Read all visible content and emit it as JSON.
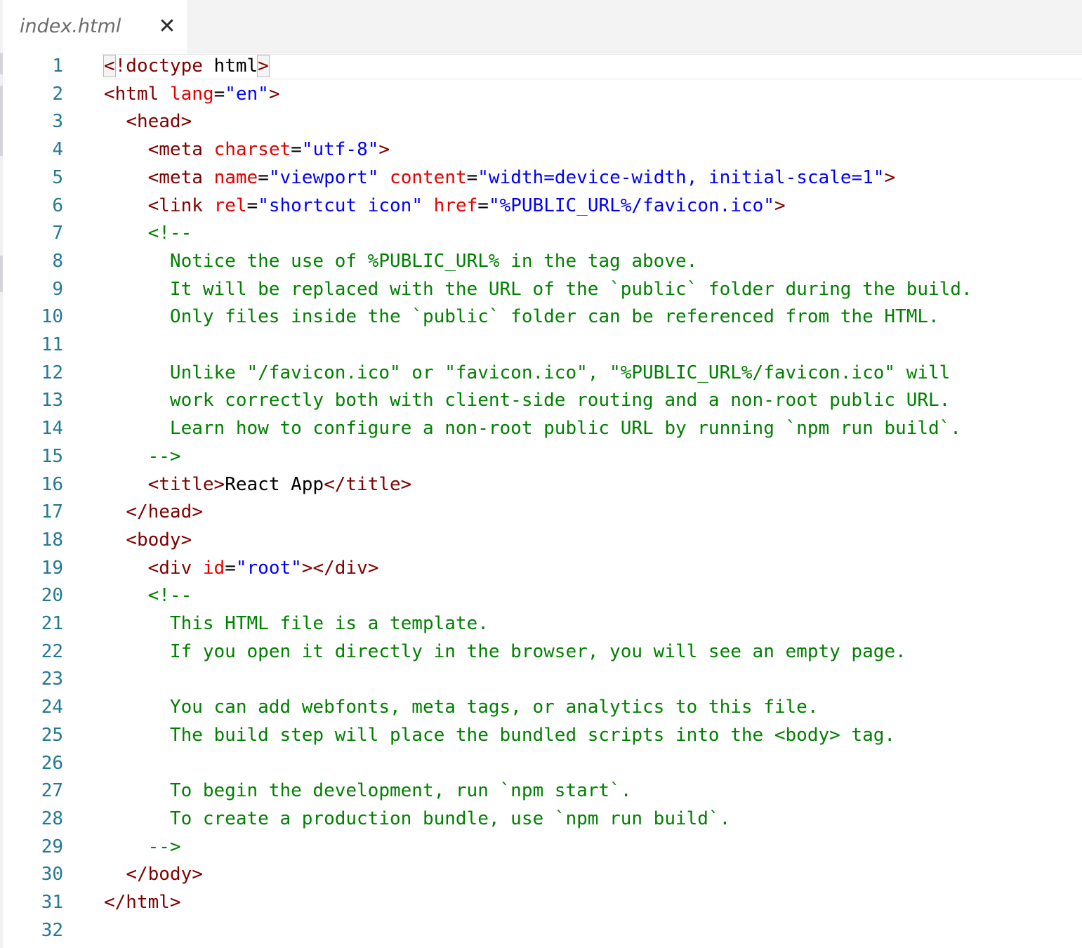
{
  "tab": {
    "filename": "index.html",
    "close_symbol": "✕"
  },
  "colors": {
    "tag": "#800000",
    "attribute": "#e50000",
    "string": "#0000ff",
    "comment": "#008000",
    "line_number": "#237893"
  },
  "lines": [
    {
      "n": "1",
      "tokens": [
        {
          "t": "tag",
          "v": "<",
          "hl": true
        },
        {
          "t": "tag",
          "v": "!doctype"
        },
        {
          "t": "txt",
          "v": " html"
        },
        {
          "t": "tag",
          "v": ">",
          "hl": true
        }
      ]
    },
    {
      "n": "2",
      "tokens": [
        {
          "t": "tag",
          "v": "<html"
        },
        {
          "t": "txt",
          "v": " "
        },
        {
          "t": "attr",
          "v": "lang"
        },
        {
          "t": "txt",
          "v": "="
        },
        {
          "t": "str",
          "v": "\"en\""
        },
        {
          "t": "tag",
          "v": ">"
        }
      ]
    },
    {
      "n": "3",
      "tokens": [
        {
          "t": "txt",
          "v": "  "
        },
        {
          "t": "tag",
          "v": "<head>"
        }
      ]
    },
    {
      "n": "4",
      "tokens": [
        {
          "t": "txt",
          "v": "    "
        },
        {
          "t": "tag",
          "v": "<meta"
        },
        {
          "t": "txt",
          "v": " "
        },
        {
          "t": "attr",
          "v": "charset"
        },
        {
          "t": "txt",
          "v": "="
        },
        {
          "t": "str",
          "v": "\"utf-8\""
        },
        {
          "t": "tag",
          "v": ">"
        }
      ]
    },
    {
      "n": "5",
      "tokens": [
        {
          "t": "txt",
          "v": "    "
        },
        {
          "t": "tag",
          "v": "<meta"
        },
        {
          "t": "txt",
          "v": " "
        },
        {
          "t": "attr",
          "v": "name"
        },
        {
          "t": "txt",
          "v": "="
        },
        {
          "t": "str",
          "v": "\"viewport\""
        },
        {
          "t": "txt",
          "v": " "
        },
        {
          "t": "attr",
          "v": "content"
        },
        {
          "t": "txt",
          "v": "="
        },
        {
          "t": "str",
          "v": "\"width=device-width, initial-scale=1\""
        },
        {
          "t": "tag",
          "v": ">"
        }
      ]
    },
    {
      "n": "6",
      "tokens": [
        {
          "t": "txt",
          "v": "    "
        },
        {
          "t": "tag",
          "v": "<link"
        },
        {
          "t": "txt",
          "v": " "
        },
        {
          "t": "attr",
          "v": "rel"
        },
        {
          "t": "txt",
          "v": "="
        },
        {
          "t": "str",
          "v": "\"shortcut icon\""
        },
        {
          "t": "txt",
          "v": " "
        },
        {
          "t": "attr",
          "v": "href"
        },
        {
          "t": "txt",
          "v": "="
        },
        {
          "t": "str",
          "v": "\"%PUBLIC_URL%/favicon.ico\""
        },
        {
          "t": "tag",
          "v": ">"
        }
      ]
    },
    {
      "n": "7",
      "tokens": [
        {
          "t": "txt",
          "v": "    "
        },
        {
          "t": "cmt",
          "v": "<!--"
        }
      ]
    },
    {
      "n": "8",
      "tokens": [
        {
          "t": "cmt",
          "v": "      Notice the use of %PUBLIC_URL% in the tag above."
        }
      ]
    },
    {
      "n": "9",
      "tokens": [
        {
          "t": "cmt",
          "v": "      It will be replaced with the URL of the `public` folder during the build."
        }
      ]
    },
    {
      "n": "10",
      "tokens": [
        {
          "t": "cmt",
          "v": "      Only files inside the `public` folder can be referenced from the HTML."
        }
      ]
    },
    {
      "n": "11",
      "tokens": []
    },
    {
      "n": "12",
      "tokens": [
        {
          "t": "cmt",
          "v": "      Unlike \"/favicon.ico\" or \"favicon.ico\", \"%PUBLIC_URL%/favicon.ico\" will"
        }
      ]
    },
    {
      "n": "13",
      "tokens": [
        {
          "t": "cmt",
          "v": "      work correctly both with client-side routing and a non-root public URL."
        }
      ]
    },
    {
      "n": "14",
      "tokens": [
        {
          "t": "cmt",
          "v": "      Learn how to configure a non-root public URL by running `npm run build`."
        }
      ]
    },
    {
      "n": "15",
      "tokens": [
        {
          "t": "cmt",
          "v": "    -->"
        }
      ]
    },
    {
      "n": "16",
      "tokens": [
        {
          "t": "txt",
          "v": "    "
        },
        {
          "t": "tag",
          "v": "<title>"
        },
        {
          "t": "txt",
          "v": "React App"
        },
        {
          "t": "tag",
          "v": "</title>"
        }
      ]
    },
    {
      "n": "17",
      "tokens": [
        {
          "t": "txt",
          "v": "  "
        },
        {
          "t": "tag",
          "v": "</head>"
        }
      ]
    },
    {
      "n": "18",
      "tokens": [
        {
          "t": "txt",
          "v": "  "
        },
        {
          "t": "tag",
          "v": "<body>"
        }
      ]
    },
    {
      "n": "19",
      "tokens": [
        {
          "t": "txt",
          "v": "    "
        },
        {
          "t": "tag",
          "v": "<div"
        },
        {
          "t": "txt",
          "v": " "
        },
        {
          "t": "attr",
          "v": "id"
        },
        {
          "t": "txt",
          "v": "="
        },
        {
          "t": "str",
          "v": "\"root\""
        },
        {
          "t": "tag",
          "v": "></div>"
        }
      ]
    },
    {
      "n": "20",
      "tokens": [
        {
          "t": "txt",
          "v": "    "
        },
        {
          "t": "cmt",
          "v": "<!--"
        }
      ]
    },
    {
      "n": "21",
      "tokens": [
        {
          "t": "cmt",
          "v": "      This HTML file is a template."
        }
      ]
    },
    {
      "n": "22",
      "tokens": [
        {
          "t": "cmt",
          "v": "      If you open it directly in the browser, you will see an empty page."
        }
      ]
    },
    {
      "n": "23",
      "tokens": []
    },
    {
      "n": "24",
      "tokens": [
        {
          "t": "cmt",
          "v": "      You can add webfonts, meta tags, or analytics to this file."
        }
      ]
    },
    {
      "n": "25",
      "tokens": [
        {
          "t": "cmt",
          "v": "      The build step will place the bundled scripts into the <body> tag."
        }
      ]
    },
    {
      "n": "26",
      "tokens": []
    },
    {
      "n": "27",
      "tokens": [
        {
          "t": "cmt",
          "v": "      To begin the development, run `npm start`."
        }
      ]
    },
    {
      "n": "28",
      "tokens": [
        {
          "t": "cmt",
          "v": "      To create a production bundle, use `npm run build`."
        }
      ]
    },
    {
      "n": "29",
      "tokens": [
        {
          "t": "cmt",
          "v": "    -->"
        }
      ]
    },
    {
      "n": "30",
      "tokens": [
        {
          "t": "txt",
          "v": "  "
        },
        {
          "t": "tag",
          "v": "</body>"
        }
      ]
    },
    {
      "n": "31",
      "tokens": [
        {
          "t": "tag",
          "v": "</html>"
        }
      ]
    },
    {
      "n": "32",
      "tokens": []
    }
  ]
}
